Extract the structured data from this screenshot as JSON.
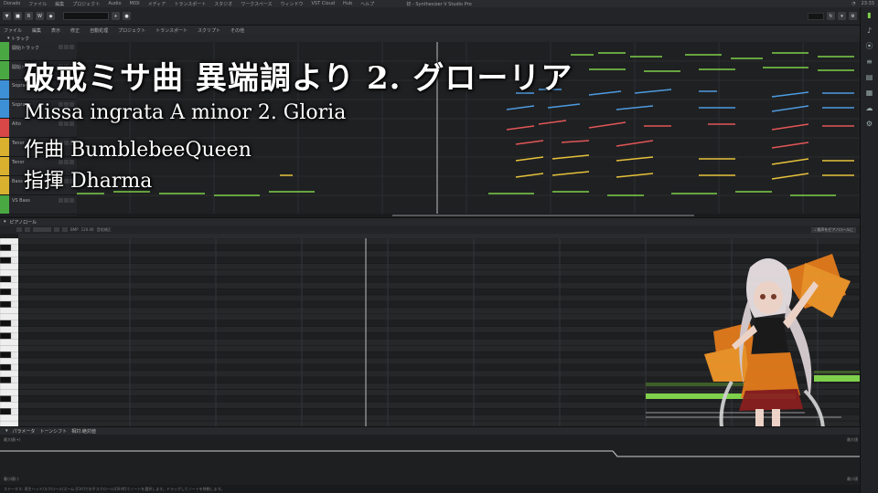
{
  "os_bar": {
    "app_name": "Dorado",
    "menus": [
      "ファイル",
      "編集",
      "プロジェクト",
      "Audio",
      "MIDI",
      "メディア",
      "トランスポート",
      "スタジオ",
      "ワークスペース",
      "ウィンドウ",
      "VST Cloud",
      "Hub",
      "ヘルプ"
    ],
    "window_title": "初 - Synthesizer V Studio Pro",
    "clock": "23:33"
  },
  "menu_bar": {
    "items": [
      "ファイル",
      "編集",
      "表示",
      "修正",
      "自動処理",
      "プロジェクト",
      "トランスポート",
      "スクリプト",
      "その他"
    ]
  },
  "tracks": {
    "header_label": "トラック",
    "items": [
      {
        "name": "開始トラック",
        "color": "#4aa843"
      },
      {
        "name": "開始トラック",
        "color": "#4aa843"
      },
      {
        "name": "Soprano",
        "color": "#3d8fd6"
      },
      {
        "name": "Soprano",
        "color": "#3d8fd6"
      },
      {
        "name": "Alto",
        "color": "#d94747"
      },
      {
        "name": "Tenor",
        "color": "#d9b12e"
      },
      {
        "name": "Tenor",
        "color": "#d9b12e"
      },
      {
        "name": "Bass",
        "color": "#d9b12e"
      },
      {
        "name": "VS Bass",
        "color": "#4aa843"
      }
    ]
  },
  "piano_roll": {
    "header_label": "ピアノロール",
    "bpm": "120.00",
    "tuning_label": "音程補正",
    "toggle_label": "♩ 歌声をピアノロールに"
  },
  "parameters": {
    "header_label": "パラメータ",
    "param_name": "トーンシフト",
    "mode_label": "相対:絶対値",
    "top_left": "最大値(+)",
    "bottom_left": "最小値(-)",
    "top_right": "最大値",
    "bottom_right": "最小値"
  },
  "status_bar": {
    "text": "ステータス: 再生ヘッド/スクロール/ズーム [Ctrl]で水平スクロール/[Shift]でノートを選択します。ドラッグしてノートを移動します。"
  },
  "overlay": {
    "title": "破戒ミサ曲 異端調より 2. グローリア",
    "subtitle": "Missa ingrata A minor 2. Gloria",
    "composer": "作曲 BumblebeeQueen",
    "conductor": "指揮 Dharma"
  },
  "colors": {
    "green": "#7fd04b",
    "blue": "#4d9be0",
    "red": "#e25656",
    "yellow": "#e6c23a",
    "playhead": "#bfbfbf"
  },
  "icons": [
    "track-icon",
    "note-icon",
    "microphone-icon",
    "document-icon",
    "cloud-icon",
    "gear-icon"
  ]
}
